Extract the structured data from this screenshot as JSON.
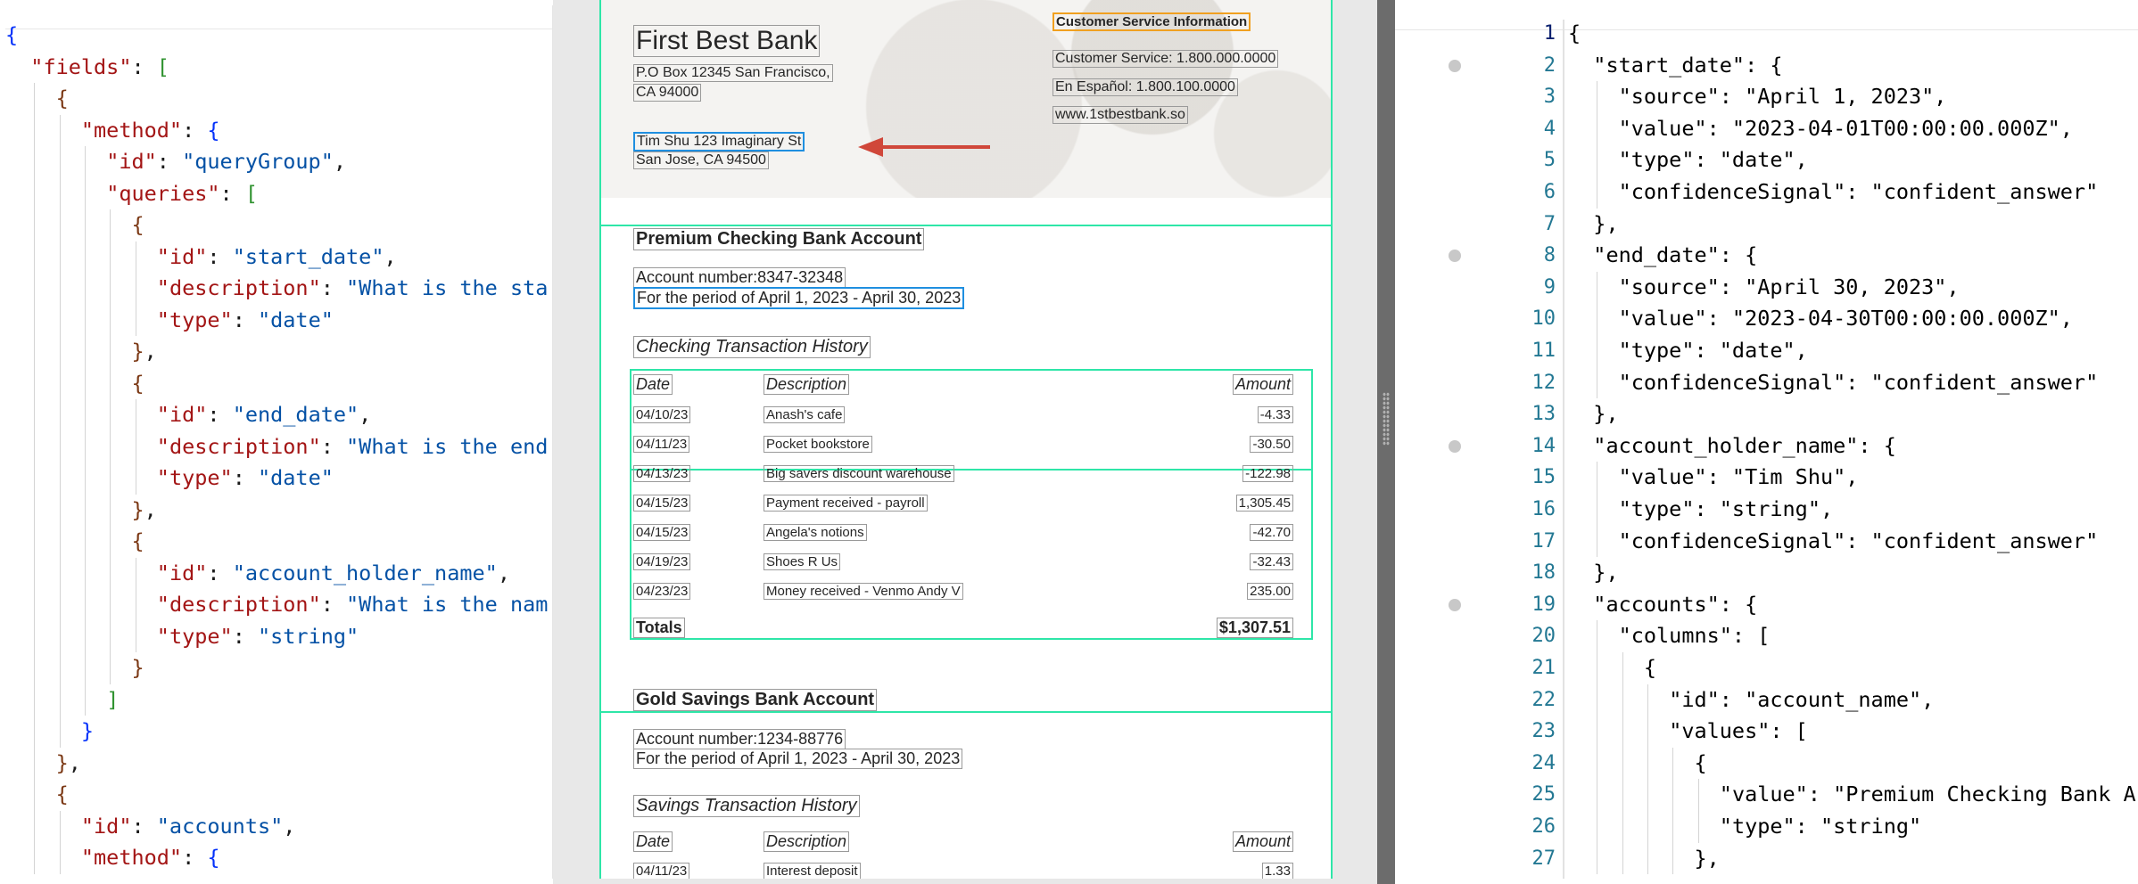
{
  "left_editor": {
    "lines": [
      {
        "indent": 0,
        "tokens": [
          {
            "t": "{",
            "c": "b1"
          }
        ]
      },
      {
        "indent": 1,
        "tokens": [
          {
            "t": "\"fields\"",
            "c": "k"
          },
          {
            "t": ": ",
            "c": ""
          },
          {
            "t": "[",
            "c": "b2"
          }
        ]
      },
      {
        "indent": 2,
        "tokens": [
          {
            "t": "{",
            "c": "b3"
          }
        ]
      },
      {
        "indent": 3,
        "tokens": [
          {
            "t": "\"method\"",
            "c": "k"
          },
          {
            "t": ": ",
            "c": ""
          },
          {
            "t": "{",
            "c": "b1"
          }
        ]
      },
      {
        "indent": 4,
        "tokens": [
          {
            "t": "\"id\"",
            "c": "k"
          },
          {
            "t": ": ",
            "c": ""
          },
          {
            "t": "\"queryGroup\"",
            "c": "s"
          },
          {
            "t": ",",
            "c": ""
          }
        ]
      },
      {
        "indent": 4,
        "tokens": [
          {
            "t": "\"queries\"",
            "c": "k"
          },
          {
            "t": ": ",
            "c": ""
          },
          {
            "t": "[",
            "c": "b2"
          }
        ]
      },
      {
        "indent": 5,
        "tokens": [
          {
            "t": "{",
            "c": "b3"
          }
        ]
      },
      {
        "indent": 6,
        "tokens": [
          {
            "t": "\"id\"",
            "c": "k"
          },
          {
            "t": ": ",
            "c": ""
          },
          {
            "t": "\"start_date\"",
            "c": "s"
          },
          {
            "t": ",",
            "c": ""
          }
        ]
      },
      {
        "indent": 6,
        "tokens": [
          {
            "t": "\"description\"",
            "c": "k"
          },
          {
            "t": ": ",
            "c": ""
          },
          {
            "t": "\"What is the sta",
            "c": "s"
          }
        ]
      },
      {
        "indent": 6,
        "tokens": [
          {
            "t": "\"type\"",
            "c": "k"
          },
          {
            "t": ": ",
            "c": ""
          },
          {
            "t": "\"date\"",
            "c": "s"
          }
        ]
      },
      {
        "indent": 5,
        "tokens": [
          {
            "t": "}",
            "c": "b3"
          },
          {
            "t": ",",
            "c": ""
          }
        ]
      },
      {
        "indent": 5,
        "tokens": [
          {
            "t": "{",
            "c": "b3"
          }
        ]
      },
      {
        "indent": 6,
        "tokens": [
          {
            "t": "\"id\"",
            "c": "k"
          },
          {
            "t": ": ",
            "c": ""
          },
          {
            "t": "\"end_date\"",
            "c": "s"
          },
          {
            "t": ",",
            "c": ""
          }
        ]
      },
      {
        "indent": 6,
        "tokens": [
          {
            "t": "\"description\"",
            "c": "k"
          },
          {
            "t": ": ",
            "c": ""
          },
          {
            "t": "\"What is the end",
            "c": "s"
          }
        ]
      },
      {
        "indent": 6,
        "tokens": [
          {
            "t": "\"type\"",
            "c": "k"
          },
          {
            "t": ": ",
            "c": ""
          },
          {
            "t": "\"date\"",
            "c": "s"
          }
        ]
      },
      {
        "indent": 5,
        "tokens": [
          {
            "t": "}",
            "c": "b3"
          },
          {
            "t": ",",
            "c": ""
          }
        ]
      },
      {
        "indent": 5,
        "tokens": [
          {
            "t": "{",
            "c": "b3"
          }
        ]
      },
      {
        "indent": 6,
        "tokens": [
          {
            "t": "\"id\"",
            "c": "k"
          },
          {
            "t": ": ",
            "c": ""
          },
          {
            "t": "\"account_holder_name\"",
            "c": "s"
          },
          {
            "t": ",",
            "c": ""
          }
        ]
      },
      {
        "indent": 6,
        "tokens": [
          {
            "t": "\"description\"",
            "c": "k"
          },
          {
            "t": ": ",
            "c": ""
          },
          {
            "t": "\"What is the nam",
            "c": "s"
          }
        ]
      },
      {
        "indent": 6,
        "tokens": [
          {
            "t": "\"type\"",
            "c": "k"
          },
          {
            "t": ": ",
            "c": ""
          },
          {
            "t": "\"string\"",
            "c": "s"
          }
        ]
      },
      {
        "indent": 5,
        "tokens": [
          {
            "t": "}",
            "c": "b3"
          }
        ]
      },
      {
        "indent": 4,
        "tokens": [
          {
            "t": "]",
            "c": "b2"
          }
        ]
      },
      {
        "indent": 3,
        "tokens": [
          {
            "t": "}",
            "c": "b1"
          }
        ]
      },
      {
        "indent": 2,
        "tokens": [
          {
            "t": "}",
            "c": "b3"
          },
          {
            "t": ",",
            "c": ""
          }
        ]
      },
      {
        "indent": 2,
        "tokens": [
          {
            "t": "{",
            "c": "b3"
          }
        ]
      },
      {
        "indent": 3,
        "tokens": [
          {
            "t": "\"id\"",
            "c": "k"
          },
          {
            "t": ": ",
            "c": ""
          },
          {
            "t": "\"accounts\"",
            "c": "s"
          },
          {
            "t": ",",
            "c": ""
          }
        ]
      },
      {
        "indent": 3,
        "tokens": [
          {
            "t": "\"method\"",
            "c": "k"
          },
          {
            "t": ": ",
            "c": ""
          },
          {
            "t": "{",
            "c": "b1"
          }
        ]
      }
    ]
  },
  "document": {
    "bank_name": "First Best Bank",
    "bank_address_1": "P.O Box 12345 San Francisco,",
    "bank_address_2": "CA 94000",
    "holder_line_1": "Tim Shu 123 Imaginary St",
    "holder_line_2": "San Jose, CA 94500",
    "cs_heading": "Customer Service Information",
    "cs_phone": "Customer Service: 1.800.000.0000",
    "cs_spanish": "En Español: 1.800.100.0000",
    "cs_web": "www.1stbestbank.so",
    "checking": {
      "title": "Premium Checking Bank Account",
      "account_number": "Account number:8347-32348",
      "period": "For the period of April 1, 2023 - April 30, 2023",
      "history_title": "Checking Transaction History",
      "col_date": "Date",
      "col_desc": "Description",
      "col_amount": "Amount",
      "rows": [
        {
          "date": "04/10/23",
          "desc": "Anash's cafe",
          "amount": "-4.33"
        },
        {
          "date": "04/11/23",
          "desc": "Pocket bookstore",
          "amount": "-30.50"
        },
        {
          "date": "04/13/23",
          "desc": "Big savers discount warehouse",
          "amount": "-122.98"
        },
        {
          "date": "04/15/23",
          "desc": "Payment received - payroll",
          "amount": "1,305.45"
        },
        {
          "date": "04/15/23",
          "desc": "Angela's notions",
          "amount": "-42.70"
        },
        {
          "date": "04/19/23",
          "desc": "Shoes R Us",
          "amount": "-32.43"
        },
        {
          "date": "04/23/23",
          "desc": "Money received - Venmo Andy V",
          "amount": "235.00"
        }
      ],
      "totals_label": "Totals",
      "totals_value": "$1,307.51"
    },
    "savings": {
      "title": "Gold Savings Bank Account",
      "account_number": "Account number:1234-88776",
      "period": "For the period of April 1, 2023 - April 30, 2023",
      "history_title": "Savings Transaction History",
      "col_date": "Date",
      "col_desc": "Description",
      "col_amount": "Amount",
      "rows": [
        {
          "date": "04/11/23",
          "desc": "Interest deposit",
          "amount": "1.33"
        }
      ]
    }
  },
  "right_editor": {
    "lines": [
      {
        "n": "1",
        "indent": 0,
        "text": "{"
      },
      {
        "n": "2",
        "indent": 1,
        "text": "\"start_date\": {"
      },
      {
        "n": "3",
        "indent": 2,
        "text": "\"source\": \"April 1, 2023\","
      },
      {
        "n": "4",
        "indent": 2,
        "text": "\"value\": \"2023-04-01T00:00:00.000Z\","
      },
      {
        "n": "5",
        "indent": 2,
        "text": "\"type\": \"date\","
      },
      {
        "n": "6",
        "indent": 2,
        "text": "\"confidenceSignal\": \"confident_answer\""
      },
      {
        "n": "7",
        "indent": 1,
        "text": "},"
      },
      {
        "n": "8",
        "indent": 1,
        "text": "\"end_date\": {"
      },
      {
        "n": "9",
        "indent": 2,
        "text": "\"source\": \"April 30, 2023\","
      },
      {
        "n": "10",
        "indent": 2,
        "text": "\"value\": \"2023-04-30T00:00:00.000Z\","
      },
      {
        "n": "11",
        "indent": 2,
        "text": "\"type\": \"date\","
      },
      {
        "n": "12",
        "indent": 2,
        "text": "\"confidenceSignal\": \"confident_answer\""
      },
      {
        "n": "13",
        "indent": 1,
        "text": "},"
      },
      {
        "n": "14",
        "indent": 1,
        "text": "\"account_holder_name\": {"
      },
      {
        "n": "15",
        "indent": 2,
        "text": "\"value\": \"Tim Shu\","
      },
      {
        "n": "16",
        "indent": 2,
        "text": "\"type\": \"string\","
      },
      {
        "n": "17",
        "indent": 2,
        "text": "\"confidenceSignal\": \"confident_answer\""
      },
      {
        "n": "18",
        "indent": 1,
        "text": "},"
      },
      {
        "n": "19",
        "indent": 1,
        "text": "\"accounts\": {"
      },
      {
        "n": "20",
        "indent": 2,
        "text": "\"columns\": ["
      },
      {
        "n": "21",
        "indent": 3,
        "text": "{"
      },
      {
        "n": "22",
        "indent": 4,
        "text": "\"id\": \"account_name\","
      },
      {
        "n": "23",
        "indent": 4,
        "text": "\"values\": ["
      },
      {
        "n": "24",
        "indent": 5,
        "text": "{"
      },
      {
        "n": "25",
        "indent": 6,
        "text": "\"value\": \"Premium Checking Bank A"
      },
      {
        "n": "26",
        "indent": 6,
        "text": "\"type\": \"string\""
      },
      {
        "n": "27",
        "indent": 5,
        "text": "},"
      }
    ]
  },
  "colors": {
    "highlight_green": "#2ee6a8",
    "highlight_blue": "#1f8fe0",
    "highlight_orange": "#f0a020",
    "arrow_red": "#d0473a",
    "line_number": "#237893"
  }
}
